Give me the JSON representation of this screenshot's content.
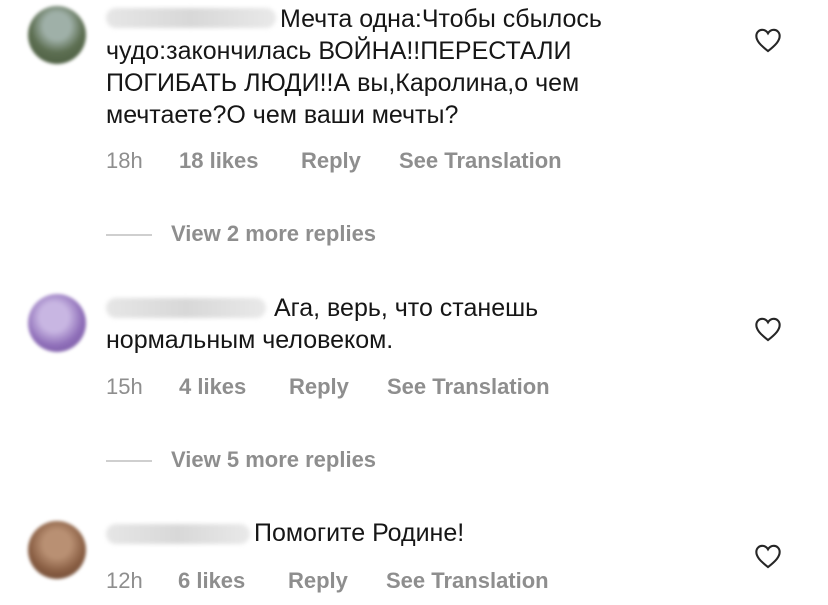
{
  "comments": [
    {
      "text": "Мечта одна:Чтобы сбылось\nчудо:закончилась ВОЙНА!!ПЕРЕСТАЛИ\nПОГИБАТЬ ЛЮДИ!!А вы,Каролина,о чем\nмечтаете?О чем ваши мечты?",
      "time": "18h",
      "likes": "18 likes",
      "reply": "Reply",
      "translate": "See Translation",
      "view_replies": "View 2 more replies"
    },
    {
      "text": "Ага, верь, что станешь\nнормальным человеком.",
      "time": "15h",
      "likes": "4 likes",
      "reply": "Reply",
      "translate": "See Translation",
      "view_replies": "View 5 more replies"
    },
    {
      "text": "Помогите Родине!",
      "time": "12h",
      "likes": "6 likes",
      "reply": "Reply",
      "translate": "See Translation"
    }
  ],
  "icons": {
    "like": "heart-outline-icon"
  },
  "colors": {
    "text": "#161616",
    "meta": "#8e8e8e",
    "divider": "#cfcfcf"
  }
}
